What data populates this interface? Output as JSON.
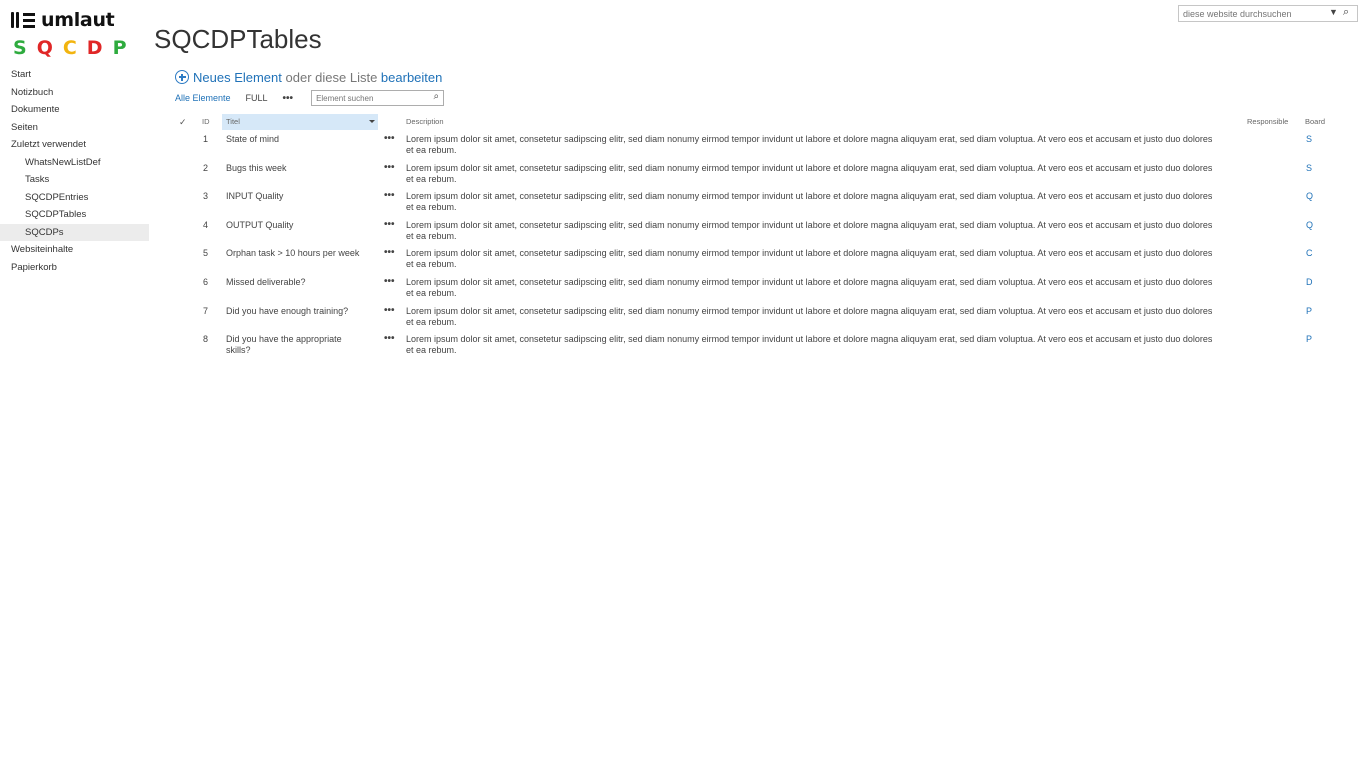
{
  "logo": {
    "word": "umlaut",
    "letters": [
      {
        "char": "S",
        "color": "#2eab3e"
      },
      {
        "char": "Q",
        "color": "#e02727"
      },
      {
        "char": "C",
        "color": "#f2b40f"
      },
      {
        "char": "D",
        "color": "#e02727"
      },
      {
        "char": "P",
        "color": "#2eab3e"
      }
    ]
  },
  "site_search": {
    "placeholder": "diese website durchsuchen"
  },
  "page_title": "SQCDPTables",
  "nav": {
    "items": [
      {
        "label": "Start",
        "level": 0
      },
      {
        "label": "Notizbuch",
        "level": 0
      },
      {
        "label": "Dokumente",
        "level": 0
      },
      {
        "label": "Seiten",
        "level": 0
      },
      {
        "label": "Zuletzt verwendet",
        "level": 0
      },
      {
        "label": "WhatsNewListDef",
        "level": 1
      },
      {
        "label": "Tasks",
        "level": 1
      },
      {
        "label": "SQCDPEntries",
        "level": 1
      },
      {
        "label": "SQCDPTables",
        "level": 1
      },
      {
        "label": "SQCDPs",
        "level": 1,
        "selected": true
      },
      {
        "label": "Websiteinhalte",
        "level": 0
      },
      {
        "label": "Papierkorb",
        "level": 0
      }
    ]
  },
  "new_item": {
    "new_label": "Neues Element",
    "middle": "oder diese Liste",
    "edit_label": "bearbeiten"
  },
  "views": {
    "all_items": "Alle Elemente",
    "full": "FULL",
    "more": "•••",
    "search_placeholder": "Element suchen"
  },
  "table": {
    "headers": {
      "check": "✓",
      "id": "ID",
      "title": "Titel",
      "description": "Description",
      "responsible": "Responsible",
      "board": "Board"
    },
    "rows": [
      {
        "id": "1",
        "title": "State of mind",
        "description": "Lorem ipsum dolor sit amet, consetetur sadipscing elitr, sed diam nonumy eirmod tempor invidunt ut labore et dolore magna aliquyam erat, sed diam voluptua. At vero eos et accusam et justo duo dolores et ea rebum.",
        "responsible": "",
        "board": "S"
      },
      {
        "id": "2",
        "title": "Bugs this week",
        "description": "Lorem ipsum dolor sit amet, consetetur sadipscing elitr, sed diam nonumy eirmod tempor invidunt ut labore et dolore magna aliquyam erat, sed diam voluptua. At vero eos et accusam et justo duo dolores et ea rebum.",
        "responsible": "",
        "board": "S"
      },
      {
        "id": "3",
        "title": "INPUT Quality",
        "description": "Lorem ipsum dolor sit amet, consetetur sadipscing elitr, sed diam nonumy eirmod tempor invidunt ut labore et dolore magna aliquyam erat, sed diam voluptua. At vero eos et accusam et justo duo dolores et ea rebum.",
        "responsible": "",
        "board": "Q"
      },
      {
        "id": "4",
        "title": "OUTPUT Quality",
        "description": "Lorem ipsum dolor sit amet, consetetur sadipscing elitr, sed diam nonumy eirmod tempor invidunt ut labore et dolore magna aliquyam erat, sed diam voluptua. At vero eos et accusam et justo duo dolores et ea rebum.",
        "responsible": "",
        "board": "Q"
      },
      {
        "id": "5",
        "title": "Orphan task > 10 hours per week",
        "description": "Lorem ipsum dolor sit amet, consetetur sadipscing elitr, sed diam nonumy eirmod tempor invidunt ut labore et dolore magna aliquyam erat, sed diam voluptua. At vero eos et accusam et justo duo dolores et ea rebum.",
        "responsible": "",
        "board": "C"
      },
      {
        "id": "6",
        "title": "Missed deliverable?",
        "description": "Lorem ipsum dolor sit amet, consetetur sadipscing elitr, sed diam nonumy eirmod tempor invidunt ut labore et dolore magna aliquyam erat, sed diam voluptua. At vero eos et accusam et justo duo dolores et ea rebum.",
        "responsible": "",
        "board": "D"
      },
      {
        "id": "7",
        "title": "Did you have enough training?",
        "description": "Lorem ipsum dolor sit amet, consetetur sadipscing elitr, sed diam nonumy eirmod tempor invidunt ut labore et dolore magna aliquyam erat, sed diam voluptua. At vero eos et accusam et justo duo dolores et ea rebum.",
        "responsible": "",
        "board": "P"
      },
      {
        "id": "8",
        "title": "Did you have the appropriate skills?",
        "description": "Lorem ipsum dolor sit amet, consetetur sadipscing elitr, sed diam nonumy eirmod tempor invidunt ut labore et dolore magna aliquyam erat, sed diam voluptua. At vero eos et accusam et justo duo dolores et ea rebum.",
        "responsible": "",
        "board": "P"
      }
    ]
  },
  "colors": {
    "link": "#2072b8",
    "selected_header": "#d6e8f8",
    "nav_selected": "#ececec"
  }
}
